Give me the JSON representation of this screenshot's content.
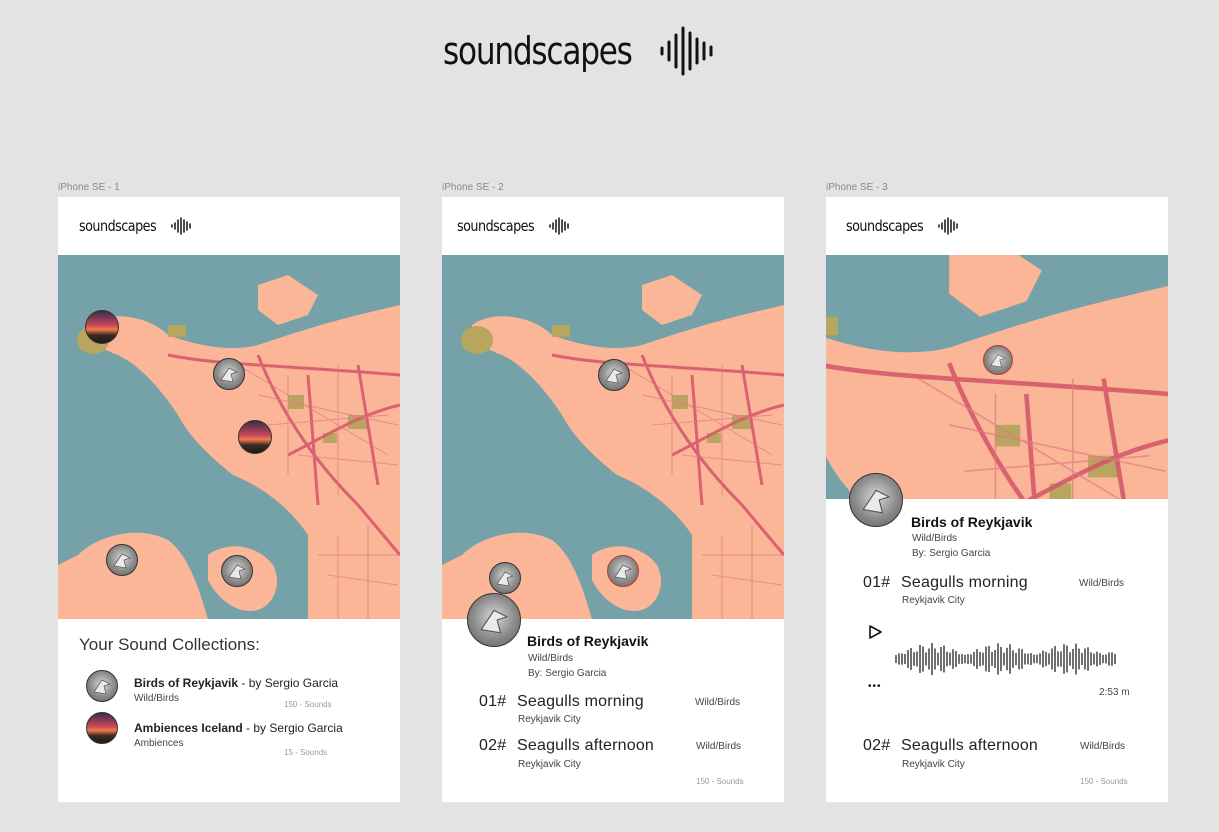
{
  "brand": {
    "name": "soundscapes"
  },
  "artboards": [
    {
      "label": "iPhone SE - 1"
    },
    {
      "label": "iPhone SE - 2"
    },
    {
      "label": "iPhone SE - 3"
    }
  ],
  "screen1": {
    "section_title": "Your Sound Collections:",
    "collections": [
      {
        "title": "Birds of Reykjavik",
        "author": " - by Sergio Garcia",
        "category": "Wild/Birds",
        "count": "150 - Sounds"
      },
      {
        "title": "Ambiences Iceland",
        "author": " - by Sergio Garcia",
        "category": "Ambiences",
        "count": "15 - Sounds"
      }
    ]
  },
  "screen2": {
    "collection_title": "Birds of Reykjavik",
    "category": "Wild/Birds",
    "author": "By: Sergio Garcia",
    "tracks": [
      {
        "num": "01#",
        "title": "Seagulls  morning",
        "location": "Reykjavik City",
        "category": "Wild/Birds"
      },
      {
        "num": "02#",
        "title": "Seagulls  afternoon",
        "location": "Reykjavik City",
        "category": "Wild/Birds"
      }
    ],
    "count": "150 - Sounds"
  },
  "screen3": {
    "collection_title": "Birds of Reykjavik",
    "category": "Wild/Birds",
    "author": "By: Sergio Garcia",
    "tracks": [
      {
        "num": "01#",
        "title": "Seagulls  morning",
        "location": "Reykjavik City",
        "category": "Wild/Birds"
      },
      {
        "num": "02#",
        "title": "Seagulls  afternoon",
        "location": "Reykjavik City",
        "category": "Wild/Birds"
      }
    ],
    "player": {
      "duration": "2:53 m",
      "more": "•••"
    },
    "count": "150 - Sounds"
  },
  "colors": {
    "water": "#74a2a8",
    "land": "#fbb597",
    "road": "#d4546a",
    "park": "#b8a55e",
    "accent": "#c0392b"
  },
  "icons": [
    "soundwave-icon",
    "bird-avatar",
    "sunset-avatar",
    "play-icon",
    "more-icon",
    "waveform-icon"
  ]
}
